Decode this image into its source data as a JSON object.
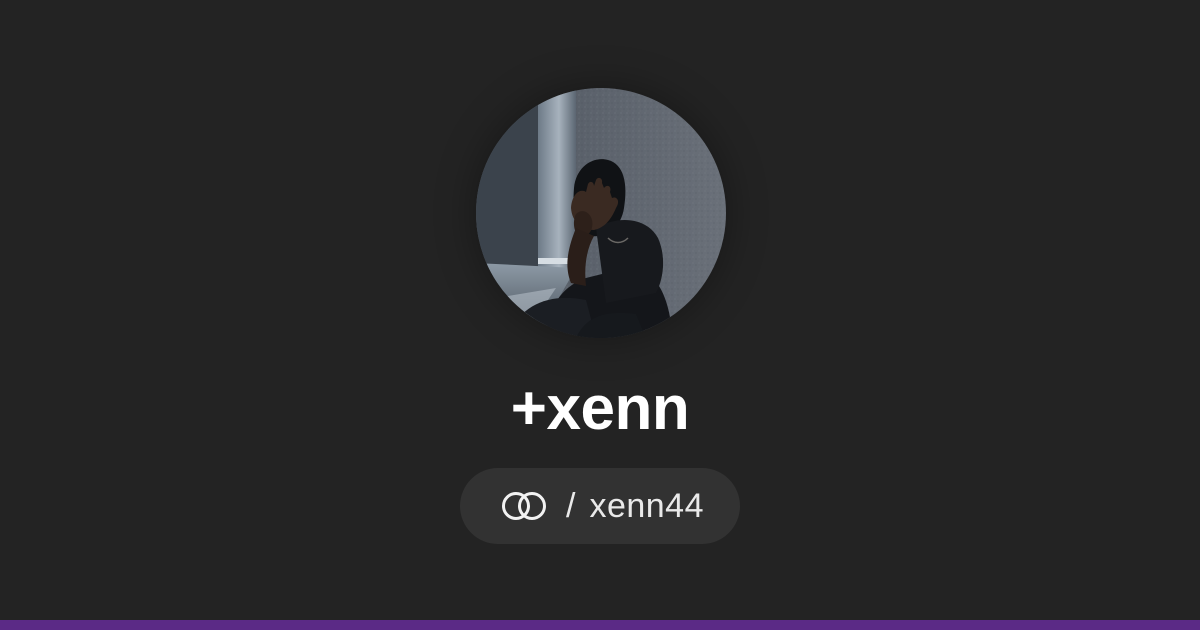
{
  "profile": {
    "display_name": "+xenn",
    "separator": "/",
    "handle": "xenn44",
    "handle_icon": "linked-rings-icon",
    "avatar_alt": "avatar-photo"
  },
  "colors": {
    "background": "#232323",
    "pill_background": "#323232",
    "text_primary": "#ffffff",
    "accent_bar": "#5b2a86"
  }
}
